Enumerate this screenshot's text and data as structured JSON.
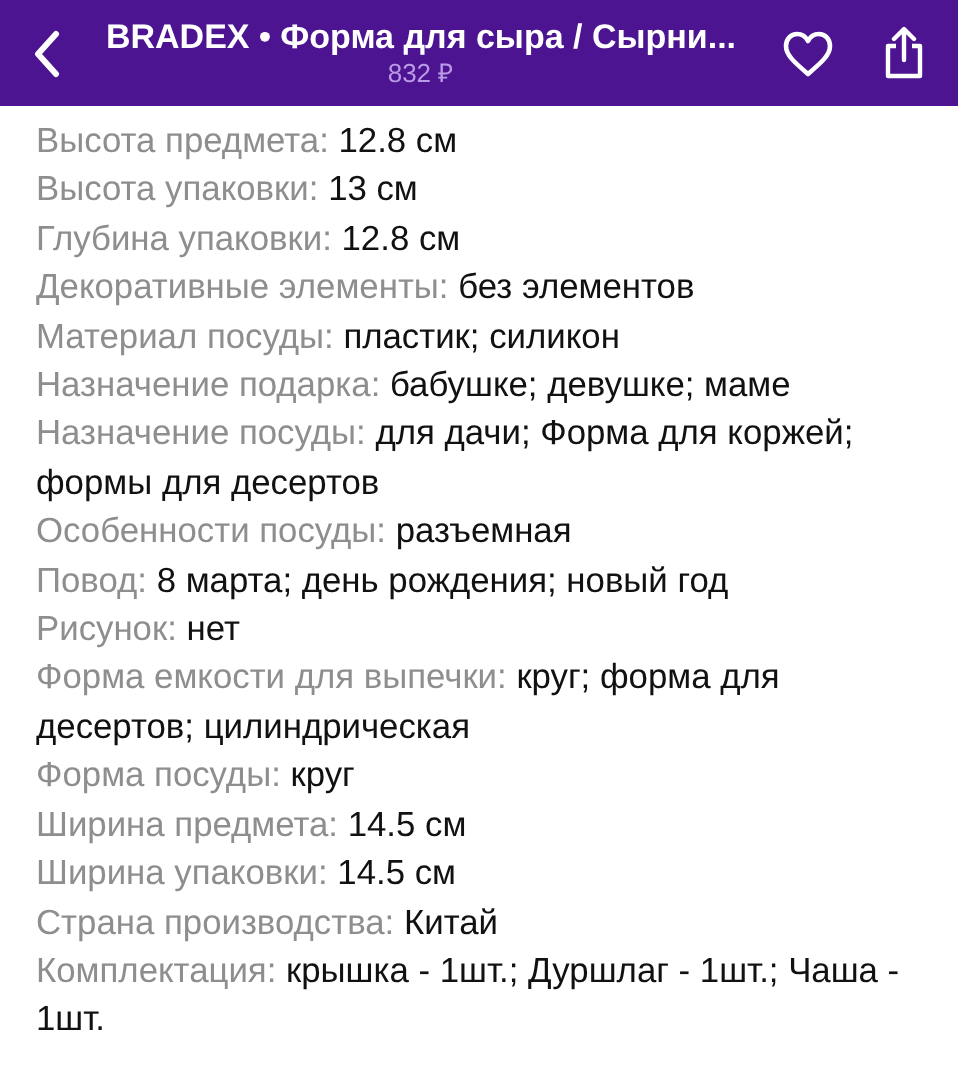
{
  "header": {
    "title": "BRADEX • Форма для сыра / Сырни...",
    "price": "832 ₽"
  },
  "specs": [
    {
      "label": "Высота предмета:",
      "value": "12.8 см"
    },
    {
      "label": "Высота упаковки:",
      "value": "13 см"
    },
    {
      "label": "Глубина упаковки:",
      "value": "12.8 см"
    },
    {
      "label": "Декоративные элементы:",
      "value": "без элементов"
    },
    {
      "label": "Материал посуды:",
      "value": "пластик; силикон"
    },
    {
      "label": "Назначение подарка:",
      "value": "бабушке; девушке; маме"
    },
    {
      "label": "Назначение посуды:",
      "value": "для дачи; Форма для коржей;",
      "value_continued": "формы для десертов"
    },
    {
      "label": "Особенности посуды:",
      "value": "разъемная"
    },
    {
      "label": "Повод:",
      "value": "8 марта; день рождения; новый год"
    },
    {
      "label": "Рисунок:",
      "value": "нет"
    },
    {
      "label": "Форма емкости для выпечки:",
      "value": "круг; форма для",
      "value_continued": "десертов; цилиндрическая"
    },
    {
      "label": "Форма посуды:",
      "value": "круг"
    },
    {
      "label": "Ширина предмета:",
      "value": "14.5 см"
    },
    {
      "label": "Ширина упаковки:",
      "value": "14.5 см"
    },
    {
      "label": "Страна производства:",
      "value": "Китай"
    },
    {
      "label": "Комплектация:",
      "value": "крышка - 1шт.; Дуршлаг - 1шт.; Чаша -",
      "value_continued": "1шт."
    }
  ]
}
